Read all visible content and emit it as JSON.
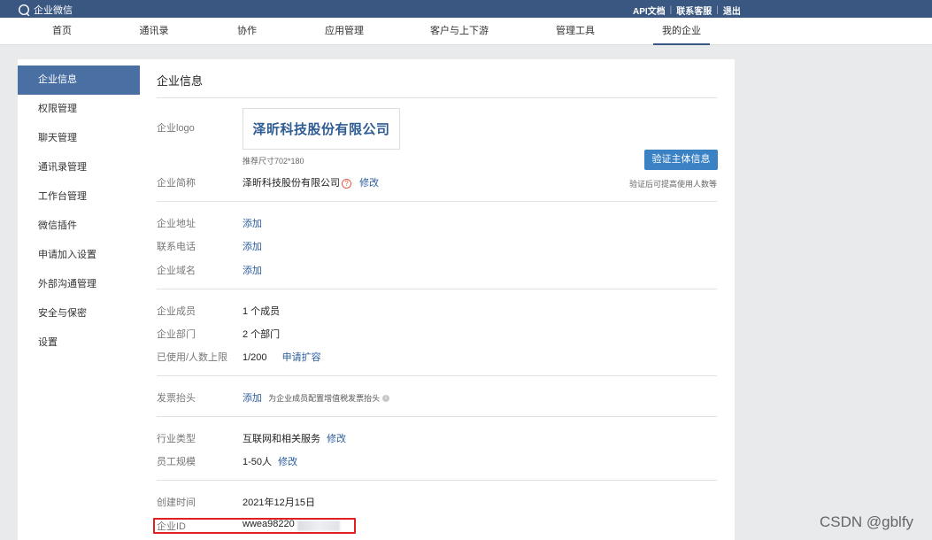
{
  "topbar": {
    "brand": "企业微信",
    "links": [
      "API文档",
      "联系客服",
      "退出"
    ],
    "separator": "|"
  },
  "nav": {
    "items": [
      "首页",
      "通讯录",
      "协作",
      "应用管理",
      "客户与上下游",
      "管理工具",
      "我的企业"
    ],
    "active": "我的企业"
  },
  "sidebar": {
    "items": [
      "企业信息",
      "权限管理",
      "聊天管理",
      "通讯录管理",
      "工作台管理",
      "微信插件",
      "申请加入设置",
      "外部沟通管理",
      "安全与保密",
      "设置"
    ],
    "active": "企业信息"
  },
  "main": {
    "title": "企业信息",
    "logo": {
      "label": "企业logo",
      "company_text": "泽昕科技股份有限公司",
      "size_hint": "推荐尺寸702*180"
    },
    "verify": {
      "button": "验证主体信息",
      "note": "验证后可提高使用人数等"
    },
    "short_name": {
      "label": "企业简称",
      "value": "泽昕科技股份有限公司",
      "help_icon": "?",
      "edit": "修改"
    },
    "address": {
      "label": "企业地址",
      "action": "添加"
    },
    "phone": {
      "label": "联系电话",
      "action": "添加"
    },
    "domain": {
      "label": "企业域名",
      "action": "添加"
    },
    "members": {
      "label": "企业成员",
      "value": "1 个成员"
    },
    "departments": {
      "label": "企业部门",
      "value": "2 个部门"
    },
    "usage": {
      "label": "已使用/人数上限",
      "value": "1/200",
      "action": "申请扩容"
    },
    "invoice": {
      "label": "发票抬头",
      "action": "添加",
      "note": "为企业成员配置增值税发票抬头",
      "info_icon": "i"
    },
    "industry": {
      "label": "行业类型",
      "value": "互联网和相关服务",
      "edit": "修改"
    },
    "staff_size": {
      "label": "员工规模",
      "value": "1-50人",
      "edit": "修改"
    },
    "created": {
      "label": "创建时间",
      "value": "2021年12月15日"
    },
    "corp_id": {
      "label": "企业ID",
      "value": "wwea98220"
    }
  },
  "watermark": "CSDN @gblfy",
  "colors": {
    "topbar": "#3a5781",
    "active_sidebar": "#4a6fa3",
    "link": "#2b5d9b",
    "button": "#3b82c4",
    "highlight_box": "#e02020"
  }
}
